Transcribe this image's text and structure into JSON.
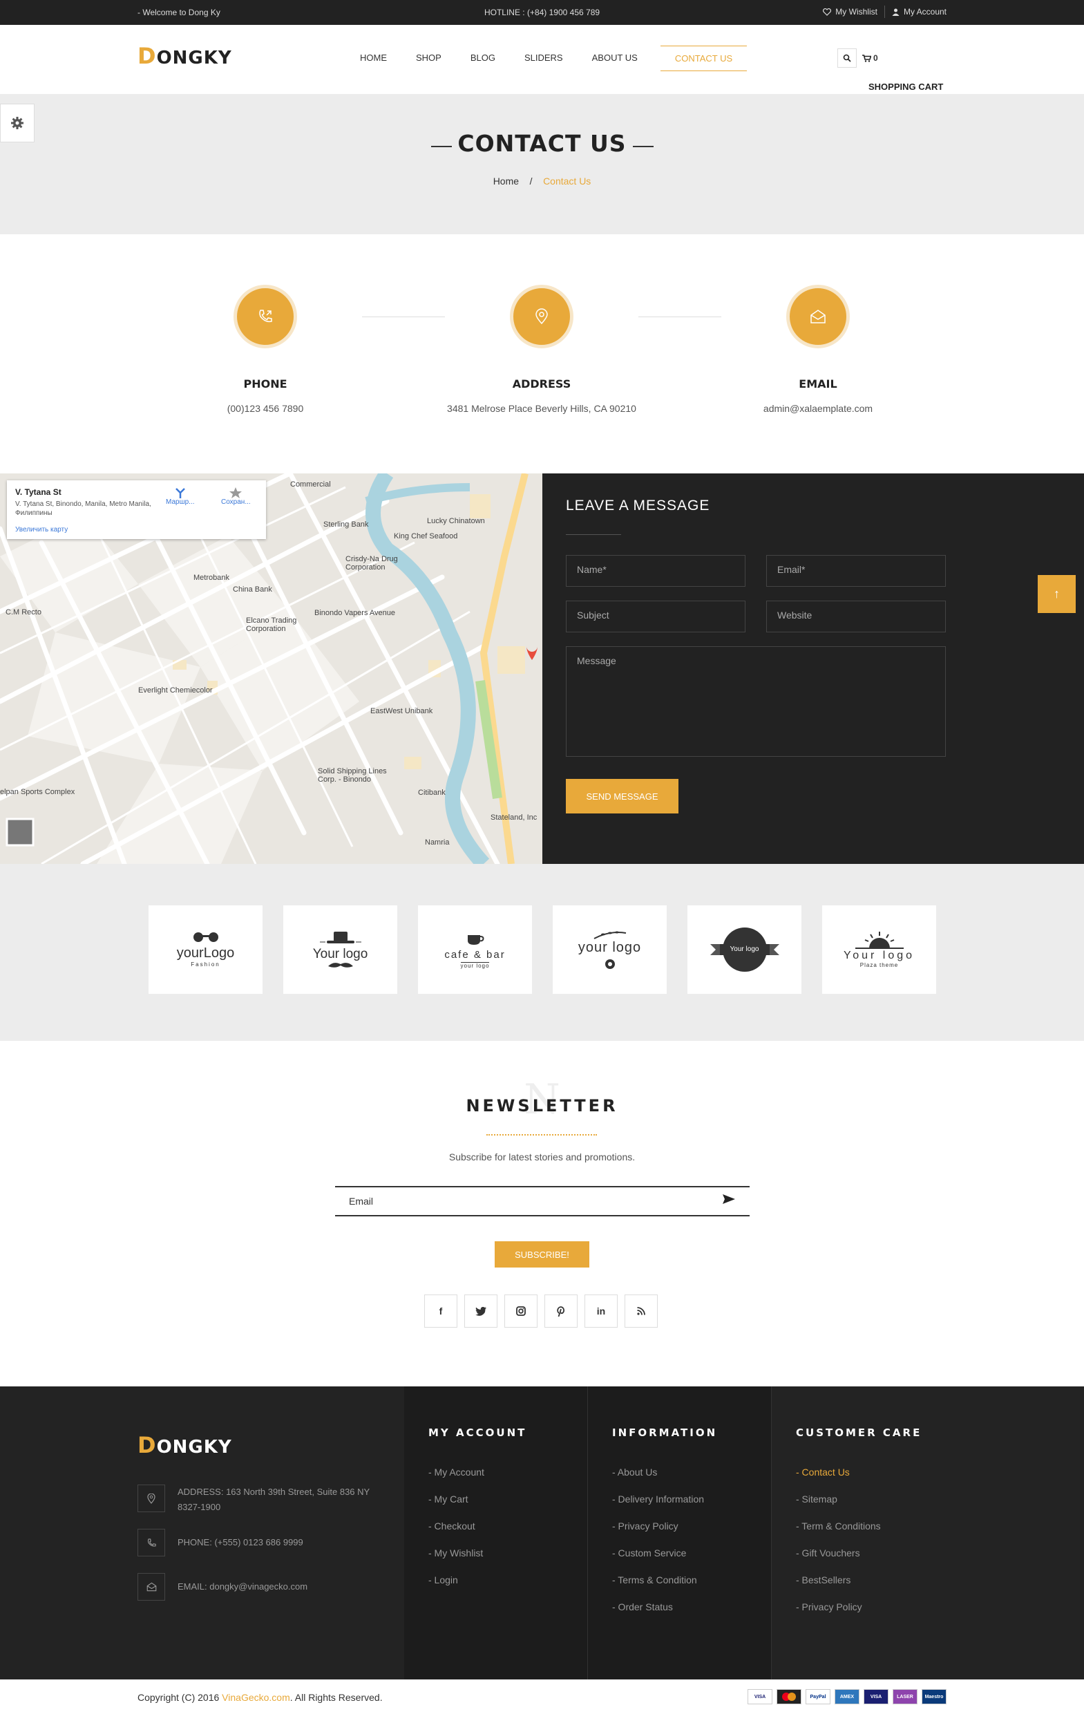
{
  "topbar": {
    "welcome": "- Welcome to Dong Ky",
    "hotline": "HOTLINE : (+84) 1900 456 789",
    "wishlist": "My Wishlist",
    "account": "My Account"
  },
  "header": {
    "logo_d": "D",
    "logo_rest": "ONGKY",
    "nav": [
      "HOME",
      "SHOP",
      "BLOG",
      "SLIDERS",
      "ABOUT US",
      "CONTACT US"
    ],
    "cart_count": "0",
    "cart_label": "SHOPPING CART"
  },
  "hero": {
    "title": "CONTACT US",
    "crumb_home": "Home",
    "crumb_sep": "/",
    "crumb_current": "Contact Us"
  },
  "contact": {
    "phone_title": "PHONE",
    "phone_value": "(00)123 456 7890",
    "address_title": "ADDRESS",
    "address_value": "3481 Melrose Place Beverly Hills, CA 90210",
    "email_title": "EMAIL",
    "email_value": "admin@xalaemplate.com"
  },
  "map": {
    "card_title": "V. Tytana St",
    "card_addr": "V. Tytana St, Binondo, Manila, Metro Manila, Филиппины",
    "card_route": "Маршр...",
    "card_save": "Сохран...",
    "card_zoom": "Увеличить карту",
    "labels": [
      "Commercial",
      "Sterling Bank",
      "Lucky Chinatown",
      "King Chef Seafood",
      "Crisdy-Na Drug Corporation",
      "Metrobank",
      "China Bank",
      "Elcano Trading Corporation",
      "Binondo Vapers Avenue",
      "Everlight Chemiecolor",
      "EastWest Unibank",
      "Solid Shipping Lines Corp. - Binondo",
      "Citibank",
      "Stateland, Inc",
      "Namria",
      "C.M Recto",
      "elpan Sports Complex"
    ]
  },
  "message": {
    "title": "LEAVE A MESSAGE",
    "name_ph": "Name*",
    "email_ph": "Email*",
    "subject_ph": "Subject",
    "website_ph": "Website",
    "message_ph": "Message",
    "send": "SEND MESSAGE"
  },
  "totop": "↑",
  "brands": [
    {
      "main": "yourLogo",
      "sub": "Fashion"
    },
    {
      "main": "Your logo",
      "sub": ""
    },
    {
      "main": "cafe & bar",
      "sub": "your logo"
    },
    {
      "main": "your logo",
      "sub": ""
    },
    {
      "main": "Your logo",
      "sub": ""
    },
    {
      "main": "Your logo",
      "sub": "Plaza theme"
    }
  ],
  "newsletter": {
    "bg_letter": "N",
    "title": "NEWSLETTER",
    "subtitle": "Subscribe for latest stories and promotions.",
    "email_ph": "Email",
    "button": "SUBSCRIBE!",
    "social": [
      "f",
      "t",
      "ig",
      "p",
      "in",
      "rss"
    ]
  },
  "footer": {
    "logo_d": "D",
    "logo_rest": "ONGKY",
    "address": "ADDRESS: 163 North 39th Street, Suite 836 NY 8327-1900",
    "phone": "PHONE: (+555) 0123 686 9999",
    "email": "EMAIL: dongky@vinagecko.com",
    "account_title": "MY ACCOUNT",
    "account_links": [
      "- My Account",
      "- My Cart",
      "- Checkout",
      "- My Wishlist",
      "- Login"
    ],
    "info_title": "INFORMATION",
    "info_links": [
      "- About Us",
      "- Delivery Information",
      "- Privacy Policy",
      "- Custom Service",
      "- Terms & Condition",
      "- Order Status"
    ],
    "care_title": "CUSTOMER CARE",
    "care_links": [
      "- Contact Us",
      "- Sitemap",
      "- Term & Conditions",
      "- Gift Vouchers",
      "- BestSellers",
      "- Privacy Policy"
    ]
  },
  "copyright": {
    "pre": "Copyright (C) 2016 ",
    "brand": "VinaGecko.com",
    "post": ". All Rights Reserved.",
    "payments": [
      "VISA",
      "MC",
      "PayPal",
      "AMEX",
      "VISA",
      "LASER",
      "Maestro"
    ]
  },
  "colors": {
    "accent": "#e8a93a",
    "dark": "#222222"
  }
}
